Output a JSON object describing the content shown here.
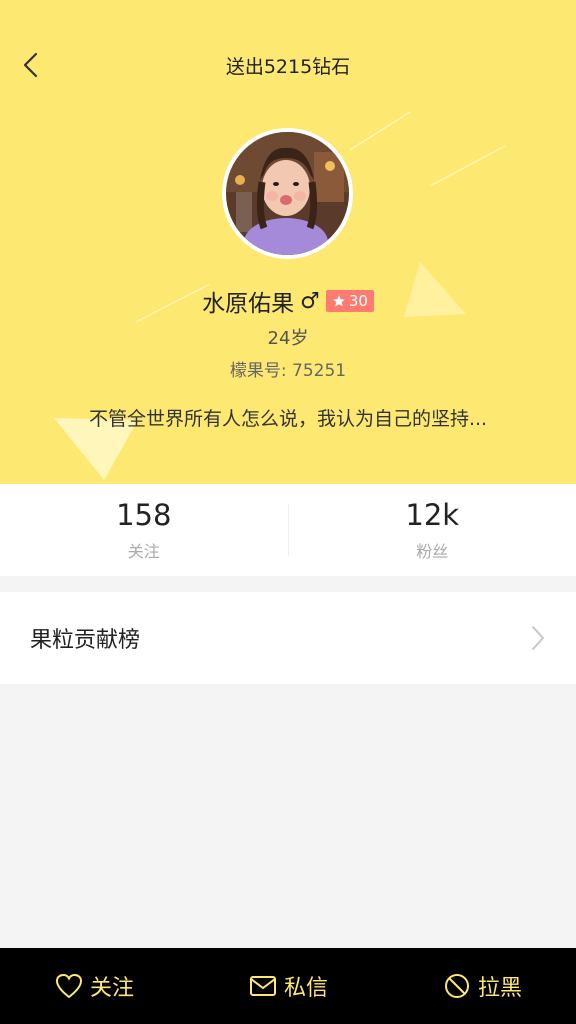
{
  "nav": {
    "title": "送出5215钻石"
  },
  "profile": {
    "name": "水原佑果",
    "gender_symbol": "♂",
    "level": "30",
    "age": "24岁",
    "id_label": "檬果号: 75251",
    "bio": "不管全世界所有人怎么说，我认为自己的坚持..."
  },
  "stats": {
    "following_count": "158",
    "following_label": "关注",
    "fans_count": "12k",
    "fans_label": "粉丝"
  },
  "rank": {
    "label": "果粒贡献榜"
  },
  "bottom": {
    "follow_label": "关注",
    "message_label": "私信",
    "block_label": "拉黑"
  },
  "colors": {
    "header_bg": "#fde872",
    "level_badge": "#ff7a70",
    "bottom_bar": "#000000",
    "bottom_text": "#fde872"
  }
}
